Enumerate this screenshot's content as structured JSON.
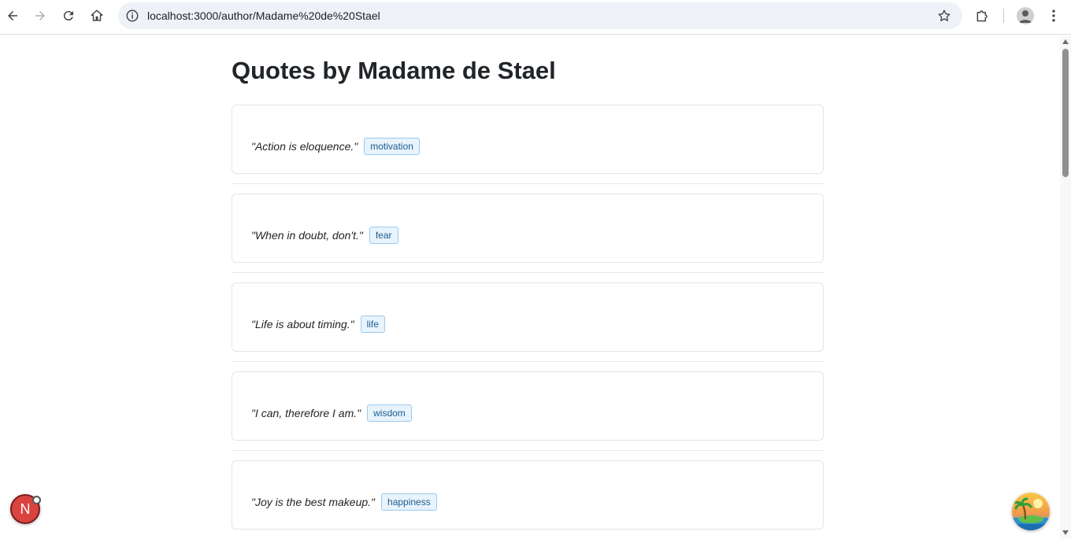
{
  "browser": {
    "url": "localhost:3000/author/Madame%20de%20Stael"
  },
  "page": {
    "title": "Quotes by Madame de Stael"
  },
  "quotes": [
    {
      "text": "\"Action is eloquence.\"",
      "tag": "motivation"
    },
    {
      "text": "\"When in doubt, don't.\"",
      "tag": "fear"
    },
    {
      "text": "\"Life is about timing.\"",
      "tag": "life"
    },
    {
      "text": "\"I can, therefore I am.\"",
      "tag": "wisdom"
    },
    {
      "text": "\"Joy is the best makeup.\"",
      "tag": "happiness"
    }
  ],
  "floating": {
    "dev_badge_letter": "N"
  },
  "colors": {
    "tag_bg": "#e7f3fd",
    "tag_border": "#9ec9ea",
    "tag_text": "#1f5c8a",
    "dev_badge": "#d9443f"
  }
}
